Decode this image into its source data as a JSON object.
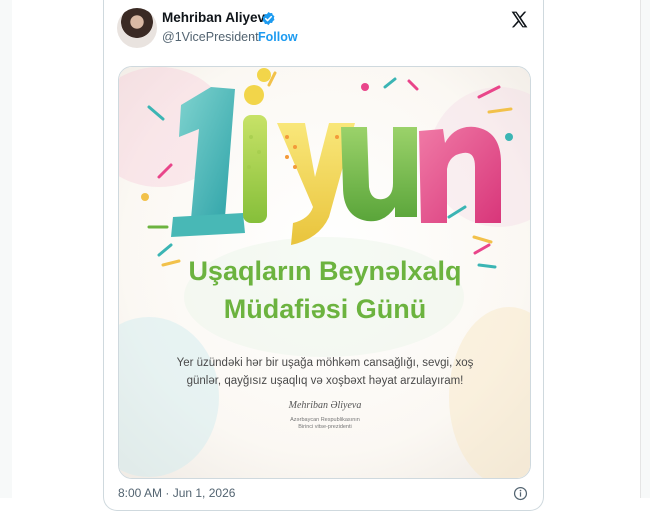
{
  "author": {
    "display_name": "Mehriban Aliyeva",
    "handle": "@1VicePresident",
    "separator": "·",
    "follow_label": "Follow"
  },
  "icons": {
    "verified": "verified-badge-icon",
    "platform": "x-logo-icon",
    "info": "info-icon"
  },
  "poster": {
    "day": "1",
    "month": "iyun",
    "headline_line1": "Uşaqların Beynəlxalq",
    "headline_line2": "Müdafiəsi Günü",
    "message_line1": "Yer üzündəki hər bir uşağa möhkəm cansağlığı, sevgi, xoş",
    "message_line2": "günlər, qayğısız uşaqlıq və xoşbəxt həyat arzulayıram!",
    "signature": "Mehriban Əliyeva",
    "title_line1": "Azərbaycan Respublikasının",
    "title_line2": "Birinci vitse-prezidenti"
  },
  "timestamp": "8:00 AM · Jun 1, 2026",
  "colors": {
    "accent_blue": "#1d9bf0",
    "headline_green": "#6cb33f",
    "teal": "#3bb5b4",
    "pink": "#e9458a",
    "lime": "#a9d046",
    "yellow": "#f2d54a"
  }
}
